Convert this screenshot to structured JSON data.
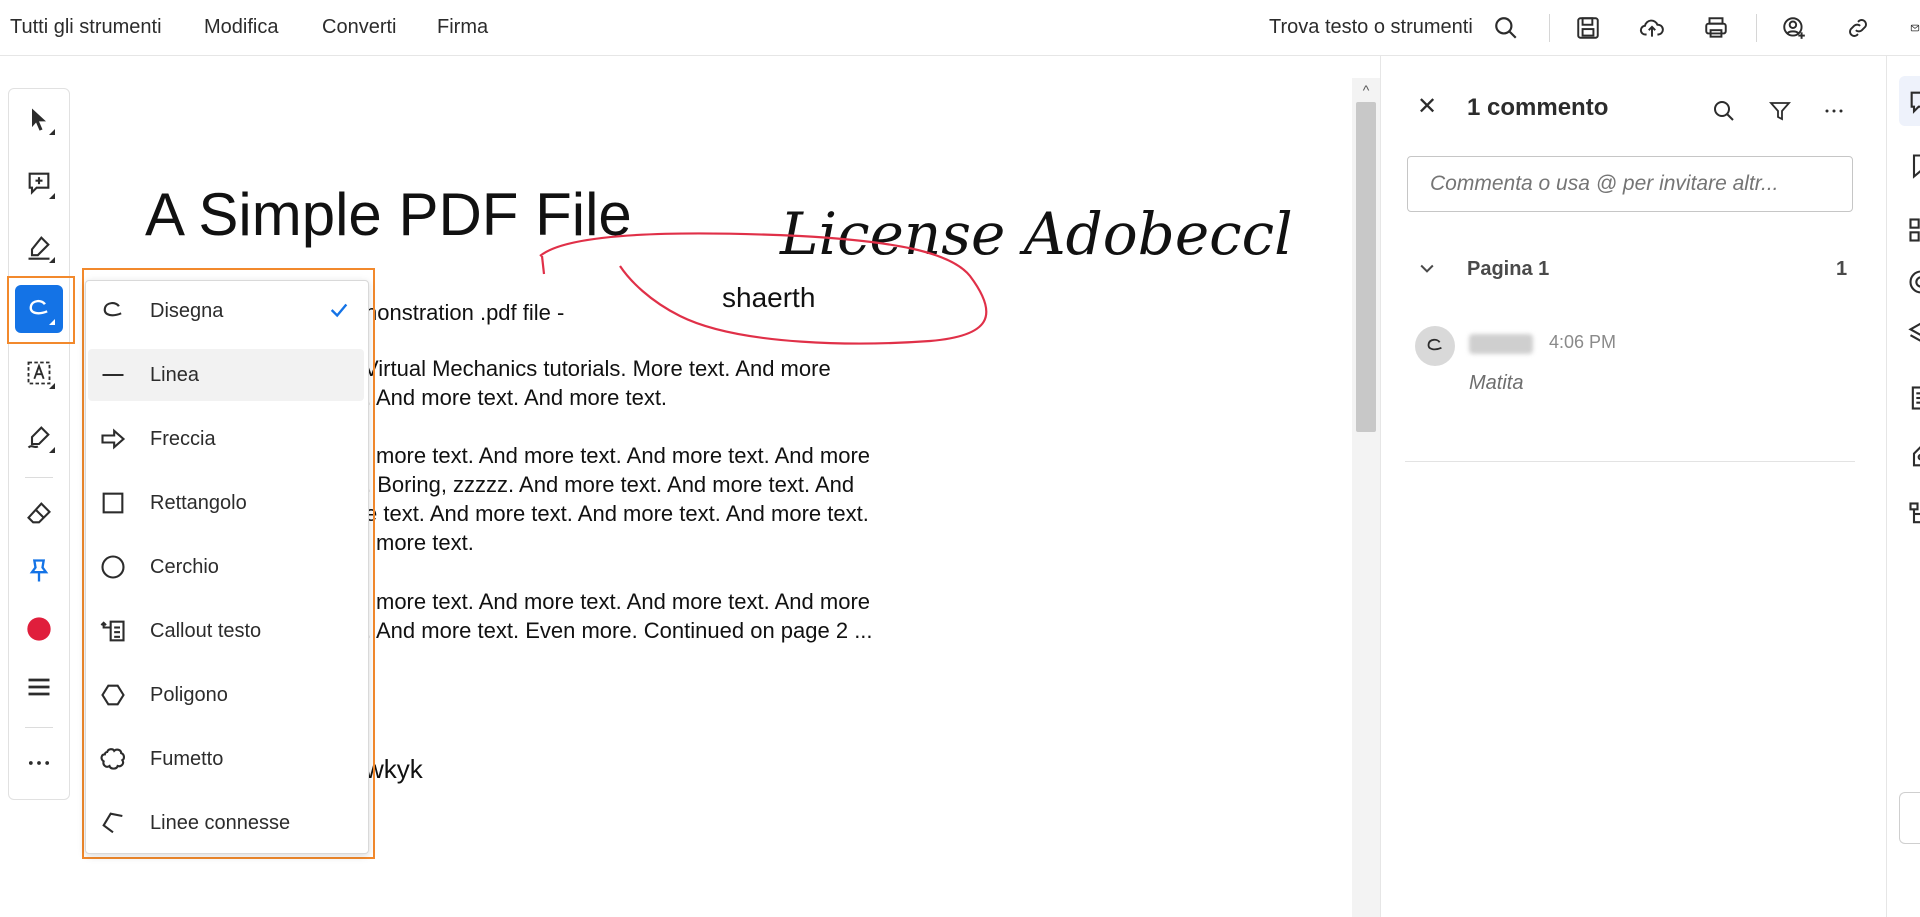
{
  "menu": {
    "all_tools": "Tutti gli strumenti",
    "edit": "Modifica",
    "convert": "Converti",
    "sign": "Firma",
    "search_label": "Trova testo o strumenti"
  },
  "document": {
    "title": "A Simple PDF File",
    "lines": [
      "nonstration .pdf file -",
      "Virtual Mechanics tutorials. More text. And more",
      ". And more text. And more text.",
      "l more text. And more text. And more text. And more",
      ". Boring, zzzzz. And more text. And more text. And",
      "e text. And more text. And more text. And more text.",
      "l more text.",
      "l more text. And more text. And more text. And more",
      ". And more text. Even more. Continued on page 2 ...",
      "wkyk"
    ],
    "signature_text": "License Adobeccl",
    "annotation_text": "shaerth"
  },
  "draw_menu": {
    "items": [
      {
        "label": "Disegna",
        "icon": "draw-icon",
        "checked": true
      },
      {
        "label": "Linea",
        "icon": "line-icon"
      },
      {
        "label": "Freccia",
        "icon": "arrow-icon"
      },
      {
        "label": "Rettangolo",
        "icon": "rectangle-icon"
      },
      {
        "label": "Cerchio",
        "icon": "circle-icon"
      },
      {
        "label": "Callout testo",
        "icon": "text-callout-icon"
      },
      {
        "label": "Poligono",
        "icon": "polygon-icon"
      },
      {
        "label": "Fumetto",
        "icon": "cloud-icon"
      },
      {
        "label": "Linee connesse",
        "icon": "polyline-icon"
      }
    ]
  },
  "comments": {
    "title": "1 commento",
    "input_placeholder": "Commenta o usa @ per invitare altr...",
    "page_label": "Pagina 1",
    "page_count": "1",
    "entry": {
      "time": "4:06 PM",
      "type": "Matita"
    }
  },
  "colors": {
    "accent": "#1473e6",
    "highlight_outline": "#f2892c",
    "ink_red": "#e03048",
    "color_swatch": "#e01e3c"
  }
}
